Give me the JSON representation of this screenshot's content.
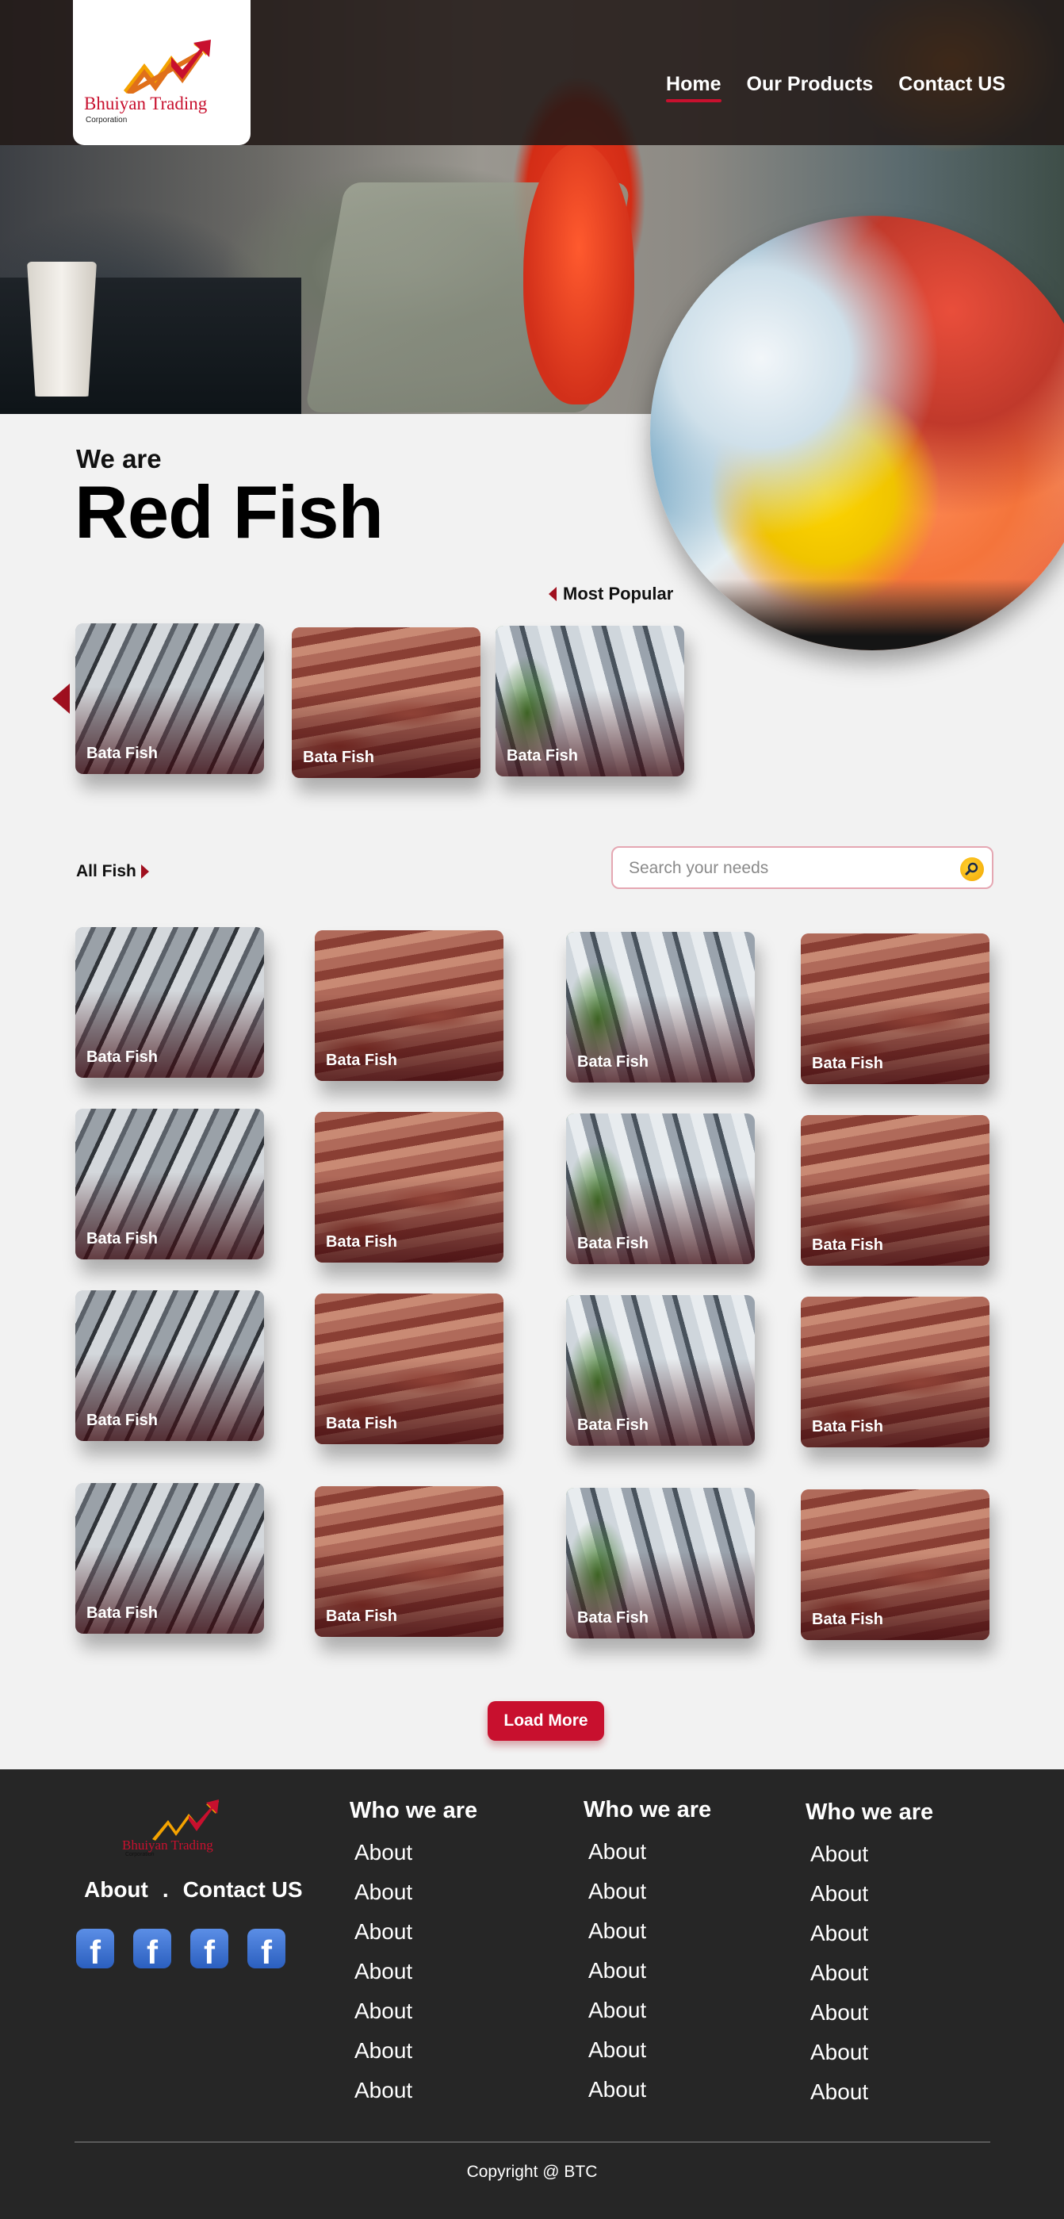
{
  "brand": {
    "name": "Bhuiyan Trading",
    "sub": "Corporation",
    "accent": "#c8102e",
    "footer_bg": "#262626"
  },
  "nav": {
    "items": [
      {
        "label": "Home",
        "active": true
      },
      {
        "label": "Our Products",
        "active": false
      },
      {
        "label": "Contact US",
        "active": false
      }
    ]
  },
  "hero": {
    "we_are": "We are",
    "title": "Red Fish"
  },
  "popular": {
    "heading": "Most Popular",
    "cards": [
      {
        "label": "Bata Fish",
        "image": "mackerel"
      },
      {
        "label": "Bata Fish",
        "image": "market"
      },
      {
        "label": "Bata Fish",
        "image": "salmon"
      }
    ]
  },
  "all_fish": {
    "heading": "All Fish",
    "search_placeholder": "Search your needs",
    "rows": [
      [
        "Bata Fish",
        "Bata Fish",
        "Bata Fish",
        "Bata Fish"
      ],
      [
        "Bata Fish",
        "Bata Fish",
        "Bata Fish",
        "Bata Fish"
      ],
      [
        "Bata Fish",
        "Bata Fish",
        "Bata Fish",
        "Bata Fish"
      ],
      [
        "Bata Fish",
        "Bata Fish",
        "Bata Fish",
        "Bata Fish"
      ]
    ],
    "load_more": "Load More"
  },
  "footer": {
    "links": [
      "About",
      "Contact US"
    ],
    "separator": ".",
    "social": [
      "f",
      "f",
      "f",
      "f"
    ],
    "columns": [
      {
        "heading": "Who we are",
        "items": [
          "About",
          "About",
          "About",
          "About",
          "About",
          "About",
          "About"
        ]
      },
      {
        "heading": "Who we are",
        "items": [
          "About",
          "About",
          "About",
          "About",
          "About",
          "About",
          "About"
        ]
      },
      {
        "heading": "Who we are",
        "items": [
          "About",
          "About",
          "About",
          "About",
          "About",
          "About",
          "About"
        ]
      }
    ],
    "copyright": "Copyright @ BTC"
  }
}
